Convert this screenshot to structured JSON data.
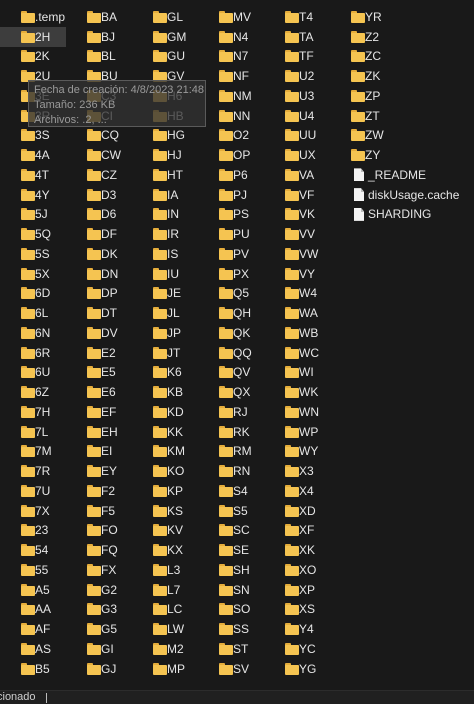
{
  "columns": [
    [
      ".temp",
      "2H",
      "2K",
      "2U",
      "3E",
      "3R",
      "3S",
      "4A",
      "4T",
      "4Y",
      "5J",
      "5Q",
      "5S",
      "5X",
      "6D",
      "6L",
      "6N",
      "6R",
      "6U",
      "6Z",
      "7H",
      "7L",
      "7M",
      "7R",
      "7U",
      "7X",
      "23",
      "54",
      "55",
      "A5",
      "AA",
      "AF",
      "AS",
      "B5"
    ],
    [
      "BA",
      "BJ",
      "BL",
      "BU",
      "C3",
      "CI",
      "CQ",
      "CW",
      "CZ",
      "D3",
      "D6",
      "DF",
      "DK",
      "DN",
      "DP",
      "DT",
      "DV",
      "E2",
      "E5",
      "E6",
      "EF",
      "EH",
      "EI",
      "EY",
      "F2",
      "F5",
      "FO",
      "FQ",
      "FX",
      "G2",
      "G3",
      "G5",
      "GI",
      "GJ"
    ],
    [
      "GL",
      "GM",
      "GU",
      "GV",
      "H6",
      "HB",
      "HG",
      "HJ",
      "HT",
      "IA",
      "IN",
      "IR",
      "IS",
      "IU",
      "JE",
      "JL",
      "JP",
      "JT",
      "K6",
      "KB",
      "KD",
      "KK",
      "KM",
      "KO",
      "KP",
      "KS",
      "KV",
      "KX",
      "L3",
      "L7",
      "LC",
      "LW",
      "M2",
      "MP"
    ],
    [
      "MV",
      "N4",
      "N7",
      "NF",
      "NM",
      "NN",
      "O2",
      "OP",
      "P6",
      "PJ",
      "PS",
      "PU",
      "PV",
      "PX",
      "Q5",
      "QH",
      "QK",
      "QQ",
      "QV",
      "QX",
      "RJ",
      "RK",
      "RM",
      "RN",
      "S4",
      "S5",
      "SC",
      "SE",
      "SH",
      "SN",
      "SO",
      "SS",
      "ST",
      "SV"
    ],
    [
      "T4",
      "TA",
      "TF",
      "U2",
      "U3",
      "U4",
      "UU",
      "UX",
      "VA",
      "VF",
      "VK",
      "VV",
      "VW",
      "VY",
      "W4",
      "WA",
      "WB",
      "WC",
      "WI",
      "WK",
      "WN",
      "WP",
      "WY",
      "X3",
      "X4",
      "XD",
      "XF",
      "XK",
      "XO",
      "XP",
      "XS",
      "Y4",
      "YC",
      "YG"
    ],
    [
      "YR",
      "Z2",
      "ZC",
      "ZK",
      "ZP",
      "ZT",
      "ZW",
      "ZY"
    ]
  ],
  "files": [
    "_README",
    "diskUsage.cache",
    "SHARDING"
  ],
  "selected": "2H",
  "tooltip": {
    "line1": "Fecha de creación: 4/8/2023 21:48",
    "line2": "Tamaño: 236 KB",
    "line3": "Archivos: .2, ..."
  },
  "status": {
    "text": "cionado"
  },
  "colors": {
    "folder": "#f5c451",
    "background": "#191919",
    "selection": "#3d3d3d"
  }
}
